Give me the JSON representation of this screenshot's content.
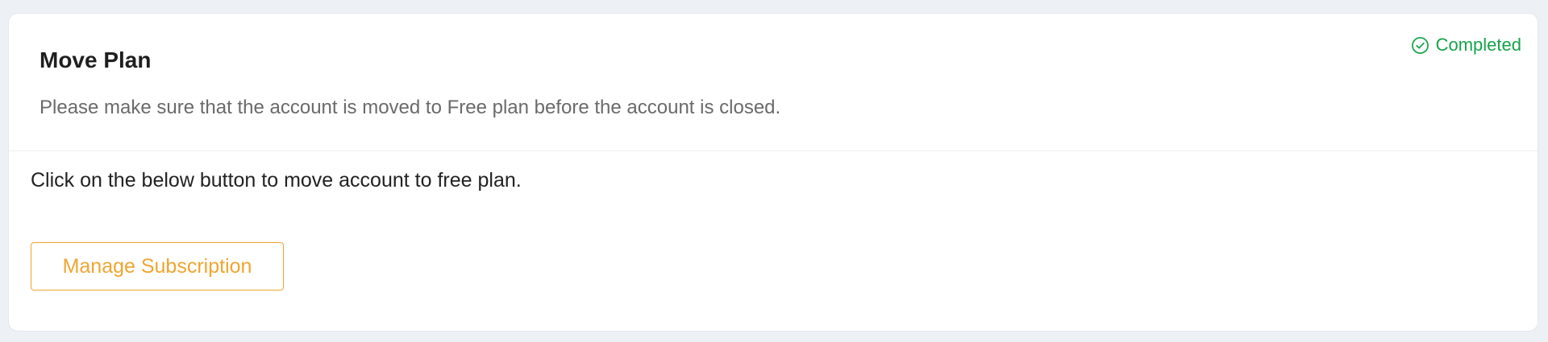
{
  "header": {
    "title": "Move Plan",
    "description": "Please make sure that the account is moved to Free plan before the account is closed.",
    "status": {
      "label": "Completed",
      "icon": "check-circle-icon",
      "color": "#16a34a"
    }
  },
  "body": {
    "instruction": "Click on the below button to move account to free plan.",
    "button_label": "Manage Subscription",
    "button_color": "#f0a531"
  }
}
